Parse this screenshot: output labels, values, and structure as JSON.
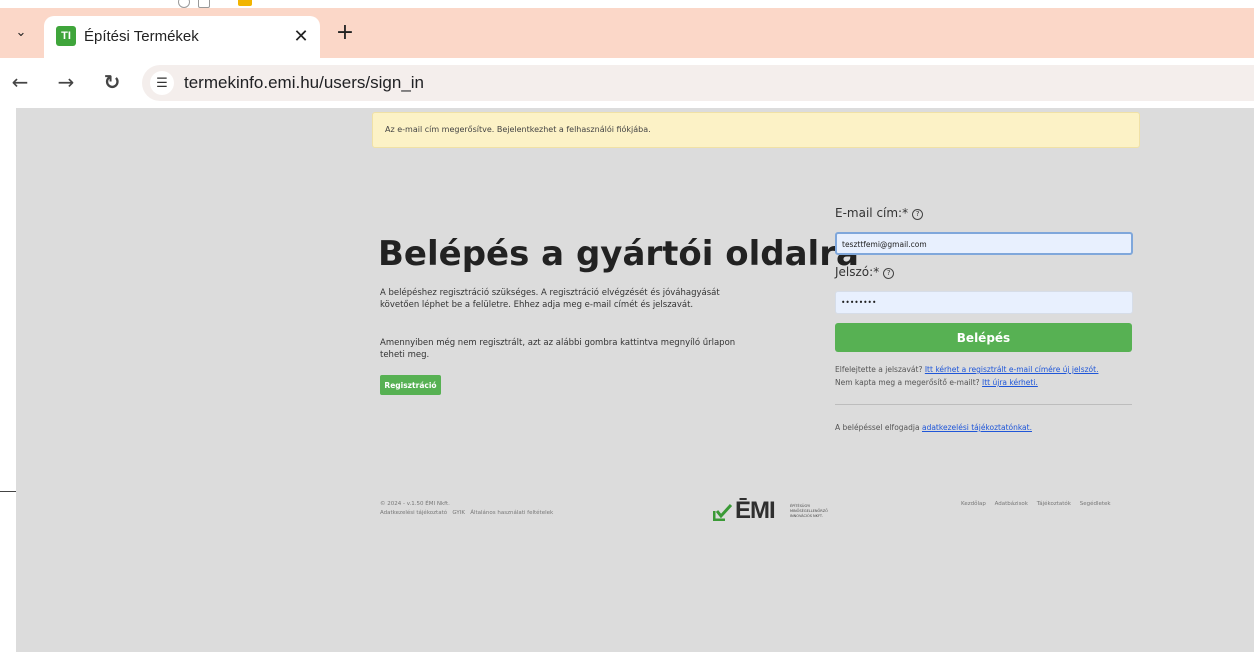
{
  "browser": {
    "tab_favicon": "TI",
    "tab_title": "Építési Termékek",
    "url": "termekinfo.emi.hu/users/sign_in"
  },
  "alert": "Az e-mail cím megerősítve. Bejelentkezhet a felhasználói fiókjába.",
  "left": {
    "title": "Belépés a gyártói oldalra",
    "intro": "A belépéshez regisztráció szükséges. A regisztráció elvégzését és jóváhagyását követően léphet be a felületre. Ehhez adja meg e-mail címét és jelszavát.",
    "intro2": "Amennyiben még nem regisztrált, azt az alábbi gombra kattintva megnyíló űrlapon teheti meg.",
    "register_button": "Regisztráció"
  },
  "form": {
    "email_label": "E-mail cím:*",
    "email_value": "teszttfemi@gmail.com",
    "password_label": "Jelszó:*",
    "password_value": "••••••••",
    "login_button": "Belépés",
    "forgot_prefix": "Elfelejtette a jelszavát?",
    "forgot_link": "Itt kérhet a regisztrált e-mail címére új jelszót.",
    "resend_prefix": "Nem kapta meg a megerősítő e-mailt?",
    "resend_link": "Itt újra kérheti.",
    "privacy_prefix": "A belépéssel elfogadja",
    "privacy_link": "adatkezelési tájékoztatónkat."
  },
  "footer": {
    "copyright": "© 2024 - v.1.50 ÉMI Nkft.",
    "links_left": [
      "Adatkezelési tájékoztató",
      "GYIK",
      "Általános használati feltételek"
    ],
    "logo_text": "ĒMI",
    "logo_sub": "ÉPÍTÉSÜGYI MINŐSÉGELLENŐRZŐ INNOVÁCIÓS NKFT.",
    "links_right": [
      "Kezdőlap",
      "Adatbázisok",
      "Tájékoztatók",
      "Segédletek"
    ]
  },
  "colors": {
    "green": "#57b153",
    "tab_bar": "#fbd7c8",
    "alert_bg": "#fcf2c6",
    "link": "#1f56d8"
  }
}
